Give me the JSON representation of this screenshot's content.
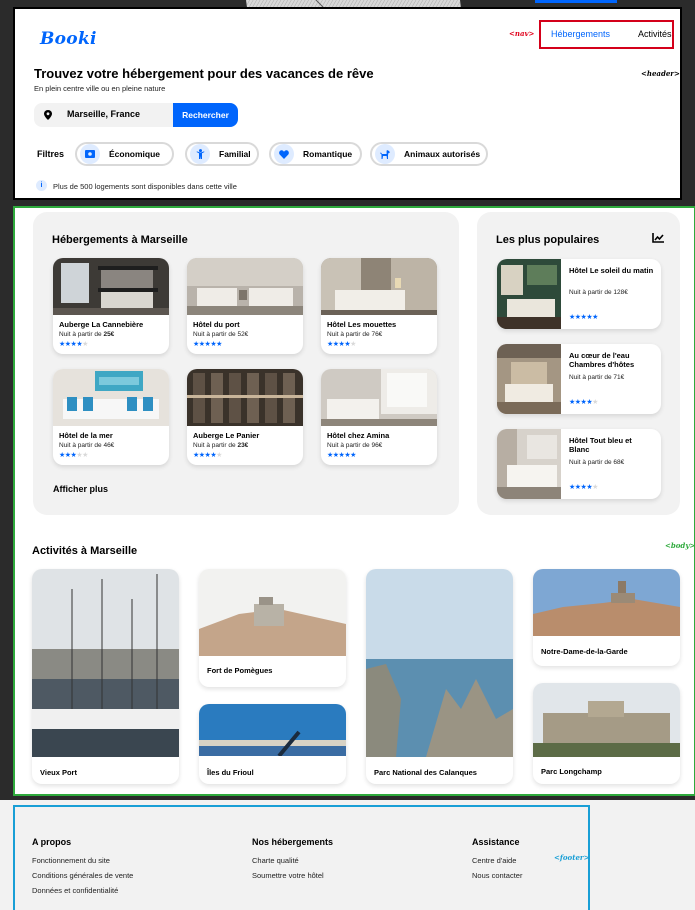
{
  "header": {
    "logo": "Booki",
    "nav_tag": "<nav>",
    "nav": [
      {
        "label": "Hébergements",
        "active": true
      },
      {
        "label": "Activités",
        "active": false
      }
    ],
    "title": "Trouvez votre hébergement pour des vacances de rêve",
    "subtitle": "En plein centre ville ou en pleine nature",
    "header_tag": "<header>",
    "search": {
      "value": "Marseille, France",
      "button": "Rechercher"
    },
    "filters_label": "Filtres",
    "filters": [
      {
        "label": "Économique",
        "icon": "money-icon"
      },
      {
        "label": "Familial",
        "icon": "child-icon"
      },
      {
        "label": "Romantique",
        "icon": "heart-icon"
      },
      {
        "label": "Animaux autorisés",
        "icon": "dog-icon"
      }
    ],
    "info": "Plus de 500 logements sont disponibles dans cette ville"
  },
  "hebergements": {
    "title": "Hébergements à Marseille",
    "cards": [
      {
        "name": "Auberge La Cannebière",
        "price_prefix": "Nuit à partir de",
        "price": "25€",
        "rating": 4
      },
      {
        "name": "Hôtel du port",
        "price_prefix": "Nuit à partir de",
        "price": "52€",
        "rating": 5
      },
      {
        "name": "Hôtel Les mouettes",
        "price_prefix": "Nuit à partir de",
        "price": "76€",
        "rating": 4
      },
      {
        "name": "Hôtel de la mer",
        "price_prefix": "Nuit à partir de",
        "price": "46€",
        "rating": 3
      },
      {
        "name": "Auberge Le Panier",
        "price_prefix": "Nuit à partir de",
        "price": "23€",
        "rating": 4
      },
      {
        "name": "Hôtel chez Amina",
        "price_prefix": "Nuit à partir de",
        "price": "96€",
        "rating": 5
      }
    ],
    "more": "Afficher plus"
  },
  "populaires": {
    "title": "Les plus populaires",
    "cards": [
      {
        "name": "Hôtel Le soleil du matin",
        "price": "Nuit à partir de 128€",
        "rating": 5
      },
      {
        "name": "Au cœur de l'eau Chambres d'hôtes",
        "price": "Nuit à partir de 71€",
        "rating": 4
      },
      {
        "name": "Hôtel Tout bleu et Blanc",
        "price": "Nuit à partir de 68€",
        "rating": 4
      }
    ]
  },
  "body_tag": "<body>",
  "activites": {
    "title": "Activités à Marseille",
    "cards": [
      {
        "label": "Vieux Port"
      },
      {
        "label": "Fort de Pomègues"
      },
      {
        "label": "Îles du Frioul"
      },
      {
        "label": "Parc National des Calanques"
      },
      {
        "label": "Notre-Dame-de-la-Garde"
      },
      {
        "label": "Parc Longchamp"
      }
    ]
  },
  "footer": {
    "tag": "<footer>",
    "columns": [
      {
        "title": "A propos",
        "links": [
          "Fonctionnement du site",
          "Conditions générales de vente",
          "Données et confidentialité"
        ]
      },
      {
        "title": "Nos hébergements",
        "links": [
          "Charte qualité",
          "Soumettre votre hôtel"
        ]
      },
      {
        "title": "Assistance",
        "links": [
          "Centre d'aide",
          "Nous contacter"
        ]
      }
    ]
  },
  "colors": {
    "primary": "#0065fc",
    "primary_light": "#deebff",
    "nav_outline": "#d4001a",
    "body_outline": "#2eaa3c",
    "footer_outline": "#199fd6",
    "panel_bg": "#f2f2f2"
  }
}
